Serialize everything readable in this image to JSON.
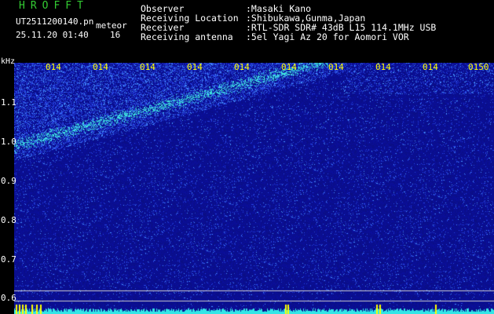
{
  "header": {
    "logo": "HROFFT",
    "file_name": "UT2511200140.pn",
    "tag": "meteor",
    "datetime": "25.11.20 01:40",
    "count": "16",
    "observer_label": "Observer",
    "observer_value": ":Masaki Kano",
    "location_label": "Receiving Location",
    "location_value": ":Shibukawa,Gunma,Japan",
    "receiver_label": "Receiver",
    "receiver_value": ":RTL-SDR SDR# 43dB L15 114.1MHz USB",
    "antenna_label": "Receiving antenna",
    "antenna_value": ":5el Yagi Az 20 for Aomori VOR"
  },
  "axis": {
    "unit": "kHz",
    "y_ticks": [
      "1.1",
      "1.0",
      "0.9",
      "0.8",
      "0.7",
      "0.6"
    ],
    "x_ticks": [
      "014",
      "014",
      "014",
      "014",
      "014",
      "014",
      "014",
      "014",
      "014",
      "0150"
    ]
  },
  "colors": {
    "logo": "#33cc33",
    "text": "#ffffff",
    "tick_text": "#ffff00",
    "background": "#0a0f96",
    "signal": "#33e6e6",
    "lines": "#cfcfcf",
    "marker": "#ffff00"
  }
}
